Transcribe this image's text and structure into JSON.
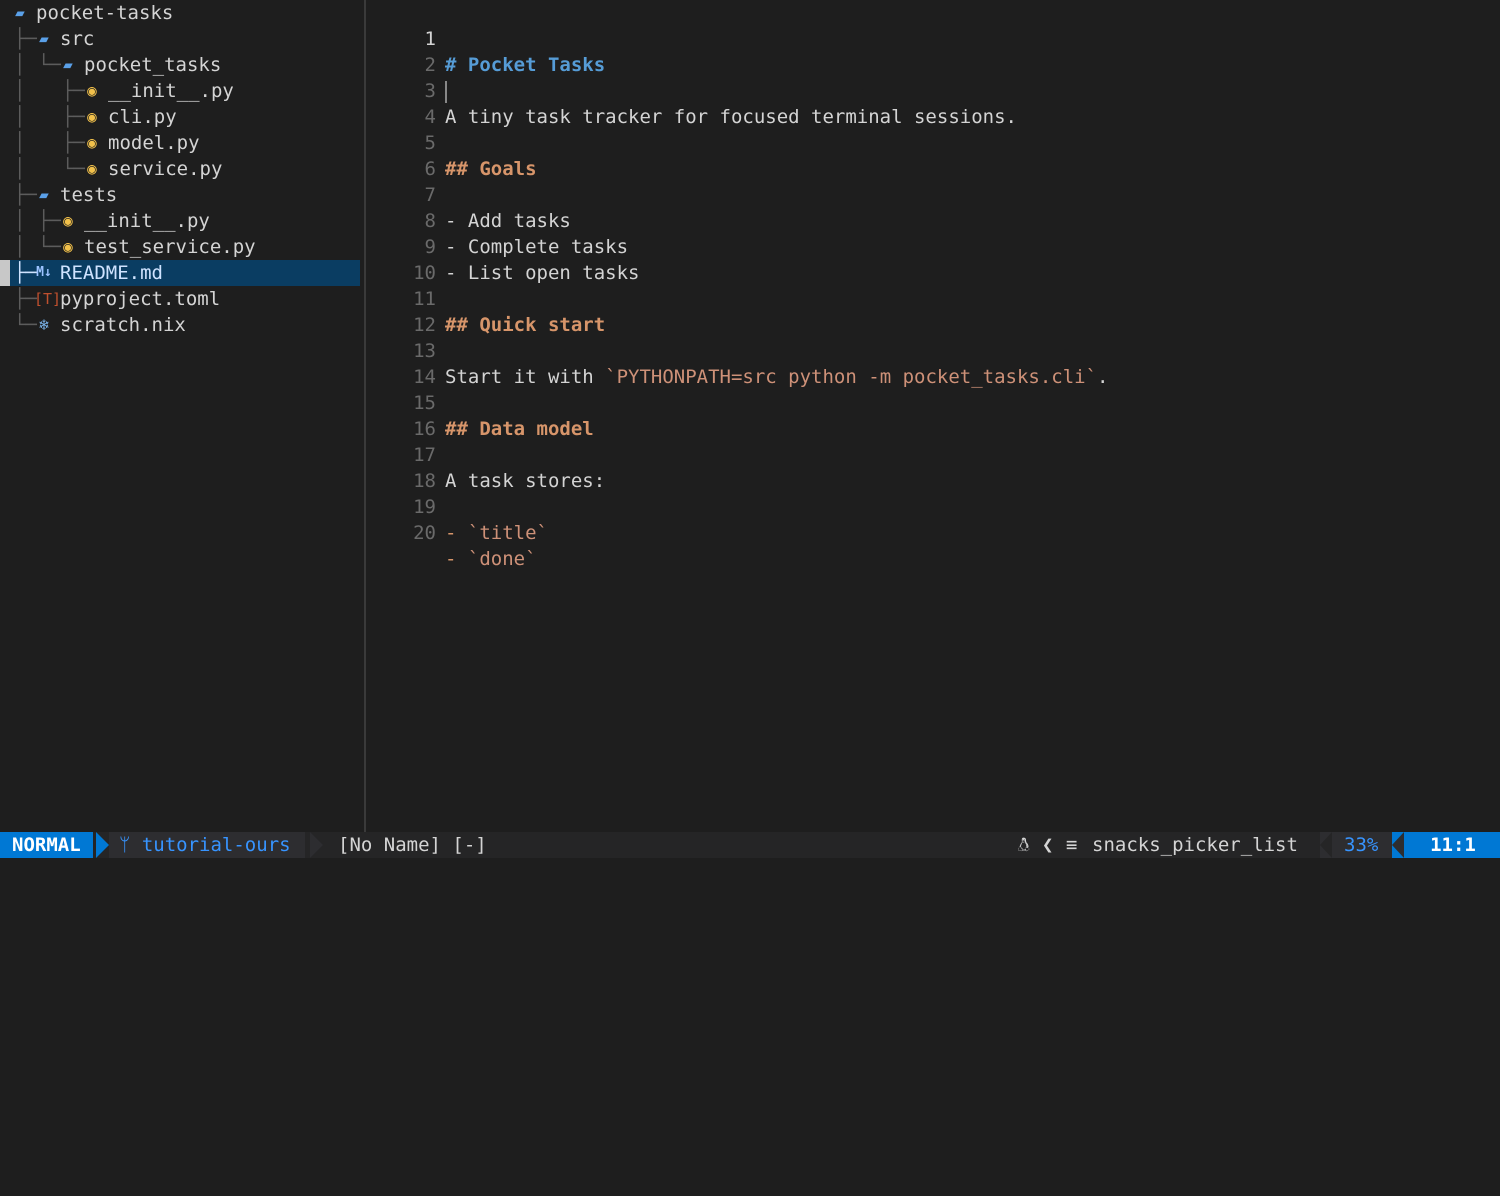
{
  "tree": {
    "items": [
      {
        "label": "pocket-tasks",
        "icon": "folder-open-icon",
        "glyph": "▰",
        "guide": ""
      },
      {
        "label": "src",
        "icon": "folder-open-icon",
        "glyph": "▰",
        "guide": "├─"
      },
      {
        "label": "pocket_tasks",
        "icon": "folder-open-icon",
        "glyph": "▰",
        "guide": "└─"
      },
      {
        "label": "__init__.py",
        "icon": "python-icon",
        "glyph": "◉",
        "guide": "├─"
      },
      {
        "label": "cli.py",
        "icon": "python-icon",
        "glyph": "◉",
        "guide": "├─"
      },
      {
        "label": "model.py",
        "icon": "python-icon",
        "glyph": "◉",
        "guide": "├─"
      },
      {
        "label": "service.py",
        "icon": "python-icon",
        "glyph": "◉",
        "guide": "└─"
      },
      {
        "label": "tests",
        "icon": "folder-open-icon",
        "glyph": "▰",
        "guide": "├─"
      },
      {
        "label": "__init__.py",
        "icon": "python-icon",
        "glyph": "◉",
        "guide": "├─"
      },
      {
        "label": "test_service.py",
        "icon": "python-icon",
        "glyph": "◉",
        "guide": "└─"
      },
      {
        "label": "README.md",
        "icon": "markdown-icon",
        "glyph": "M↓",
        "guide": "├─"
      },
      {
        "label": "pyproject.toml",
        "icon": "toml-icon",
        "glyph": "[T]",
        "guide": "├─"
      },
      {
        "label": "scratch.nix",
        "icon": "nix-snowflake-icon",
        "glyph": "❄",
        "guide": "└─"
      }
    ]
  },
  "editor": {
    "lines": [
      {
        "n": "1",
        "text": "# Pocket Tasks"
      },
      {
        "n": "2",
        "text": ""
      },
      {
        "n": "3",
        "text": "A tiny task tracker for focused terminal sessions."
      },
      {
        "n": "4",
        "text": ""
      },
      {
        "n": "5",
        "text": "## Goals"
      },
      {
        "n": "6",
        "text": ""
      },
      {
        "n": "7",
        "text": "- Add tasks"
      },
      {
        "n": "8",
        "text": "- Complete tasks"
      },
      {
        "n": "9",
        "text": "- List open tasks"
      },
      {
        "n": "10",
        "text": ""
      },
      {
        "n": "11",
        "text": "## Quick start"
      },
      {
        "n": "12",
        "text": ""
      },
      {
        "n": "13",
        "pre": "Start it with ",
        "code": "`PYTHONPATH=src python -m pocket_tasks.cli`",
        "post": "."
      },
      {
        "n": "14",
        "text": ""
      },
      {
        "n": "15",
        "text": "## Data model"
      },
      {
        "n": "16",
        "text": ""
      },
      {
        "n": "17",
        "text": "A task stores:"
      },
      {
        "n": "18",
        "text": ""
      },
      {
        "n": "19",
        "bullet": "- ",
        "code": "`title`"
      },
      {
        "n": "20",
        "bullet": "- ",
        "code": "`done`"
      }
    ]
  },
  "statusline": {
    "mode": "NORMAL",
    "branch_icon": "git-branch-icon",
    "branch": "tutorial-ours",
    "file": "[No Name]",
    "modified": "[-]",
    "os_icon": "linux-icon",
    "filetype_icon": "lines-icon",
    "filetype": "snacks_picker_list",
    "percent": "33%",
    "position": "11:1"
  },
  "colors": {
    "accent": "#0078d4",
    "selection": "#0a3d62",
    "heading1": "#569cd6",
    "heading2": "#d7956a",
    "code": "#ce9178"
  }
}
